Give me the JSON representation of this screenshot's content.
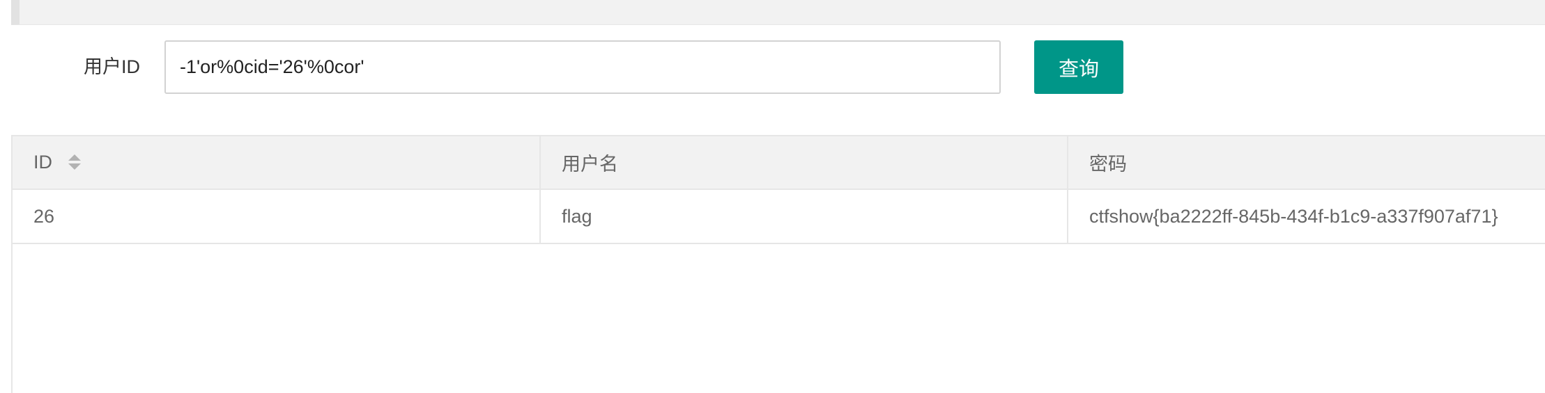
{
  "search": {
    "label": "用户ID",
    "value": "-1'or%0cid='26'%0cor'",
    "button_label": "查询"
  },
  "table": {
    "headers": [
      "ID",
      "用户名",
      "密码"
    ],
    "sortable_column": "ID",
    "rows": [
      [
        "26",
        "flag",
        "ctfshow{ba2222ff-845b-434f-b1c9-a337f907af71}"
      ]
    ]
  },
  "colors": {
    "accent": "#009688",
    "header_bg": "#f2f2f2",
    "border": "#e6e6e6"
  },
  "icons": {
    "sort": "sort-icon"
  }
}
